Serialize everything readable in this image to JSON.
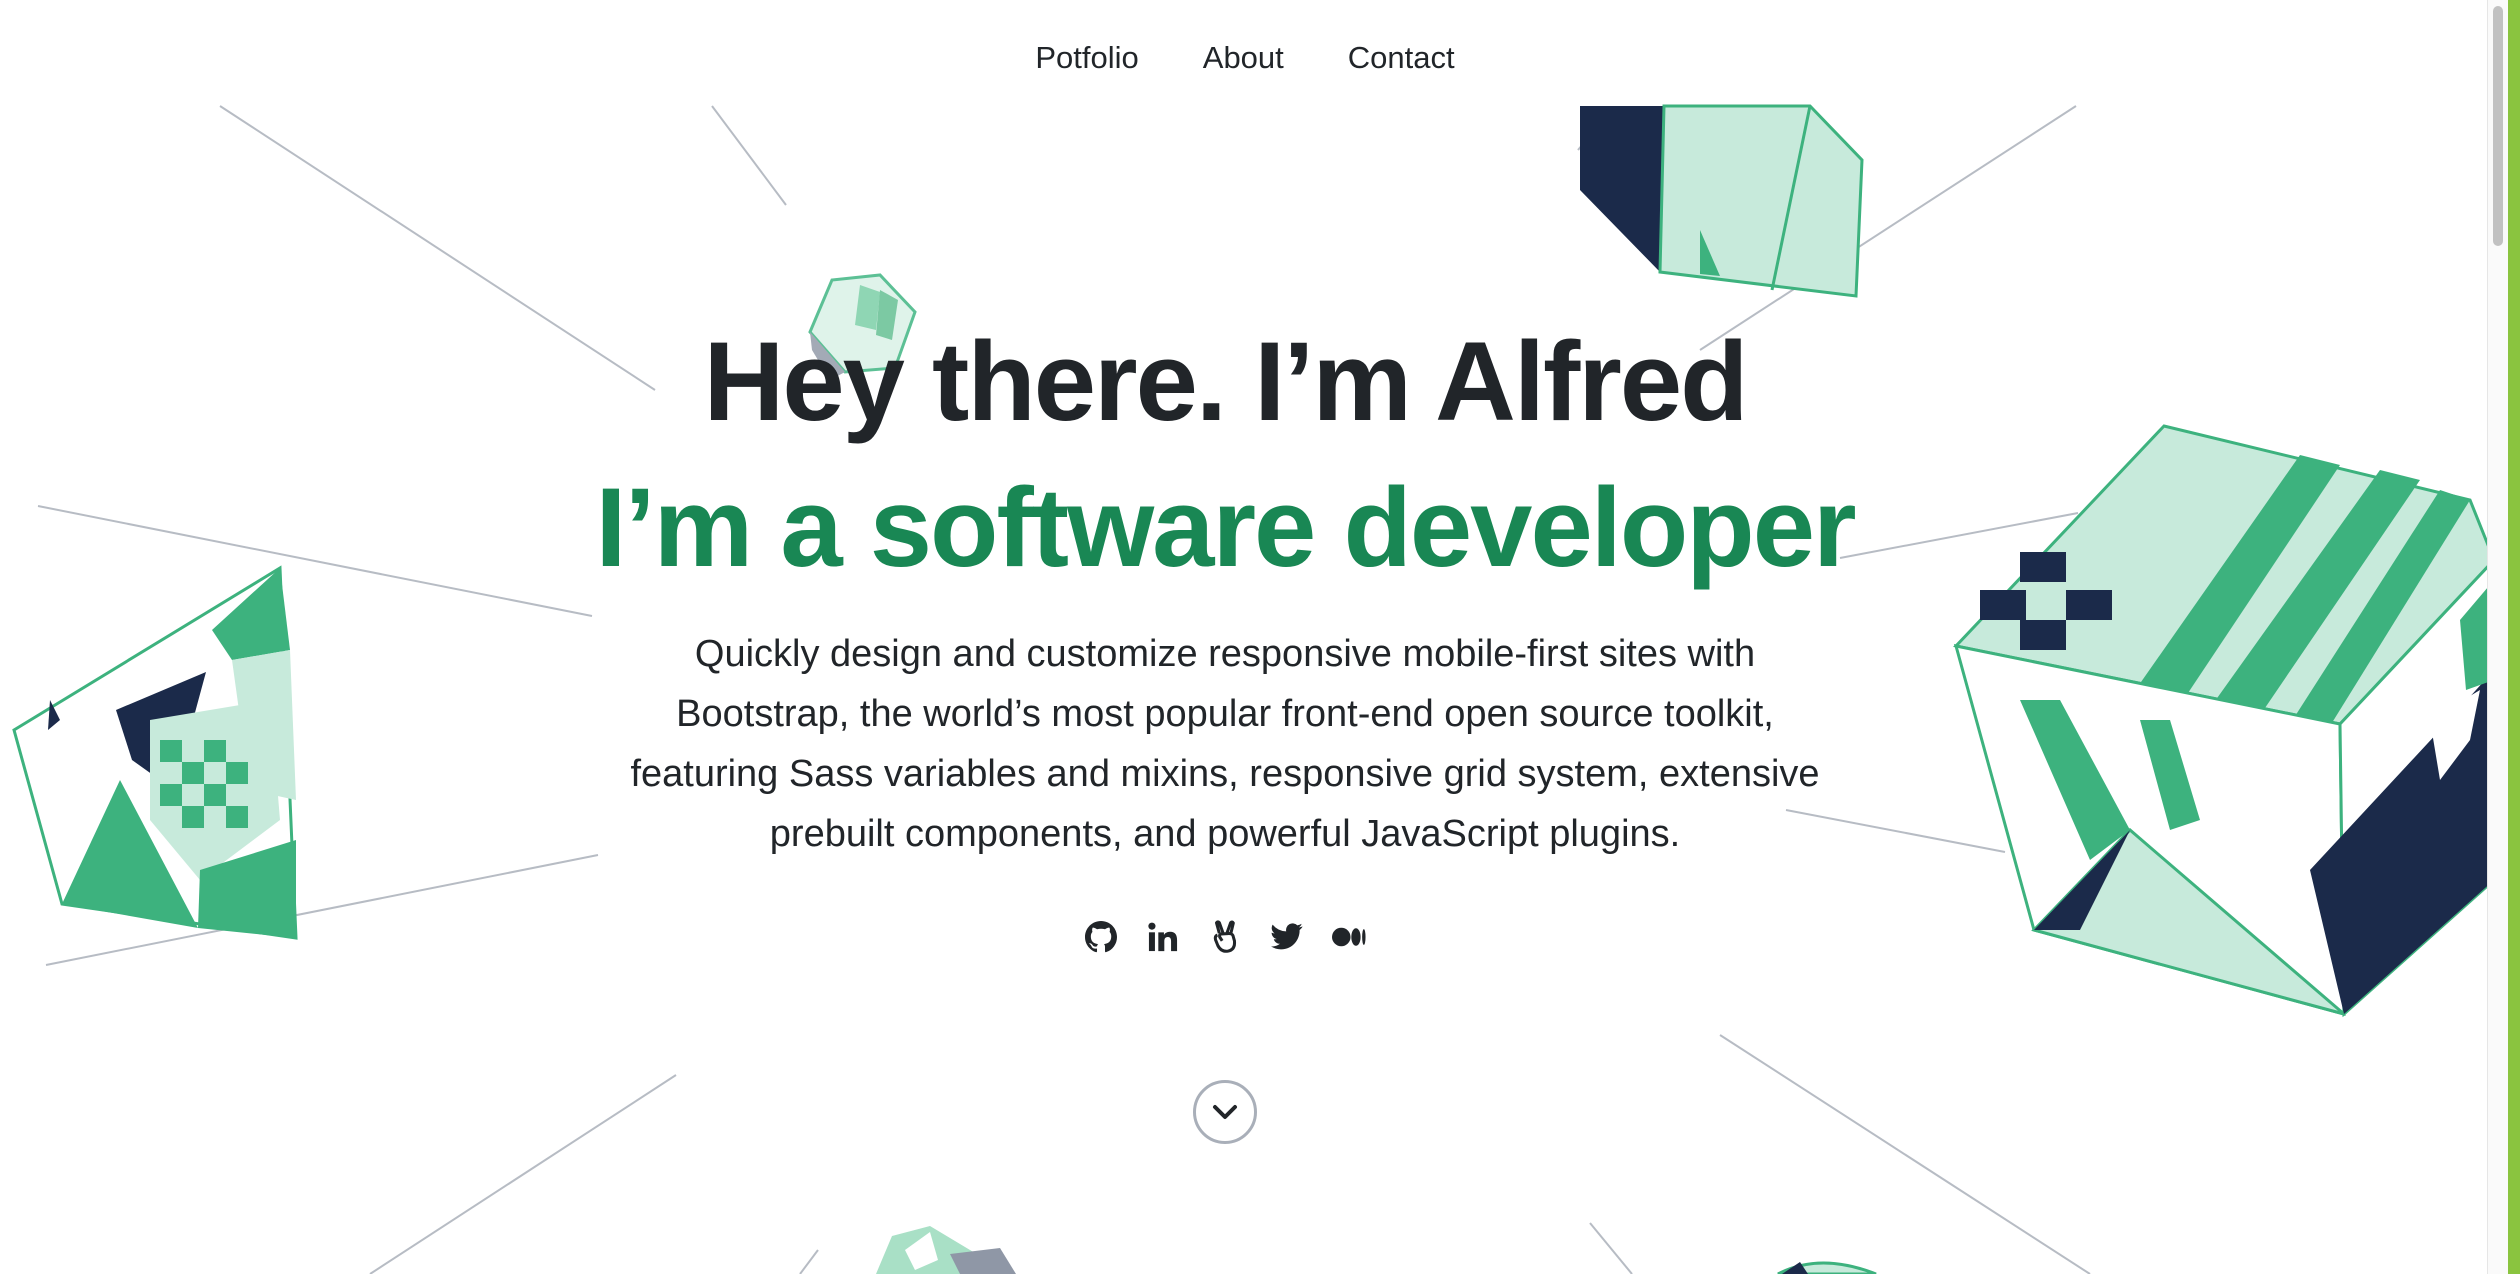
{
  "nav": {
    "items": [
      {
        "label": "Potfolio"
      },
      {
        "label": "About"
      },
      {
        "label": "Contact"
      }
    ]
  },
  "hero": {
    "title": "Hey there. I’m Alfred",
    "subtitle": "I’m a software developer",
    "description": "Quickly design and customize responsive mobile-first sites with Bootstrap, the world’s most popular front-end open source toolkit, featuring Sass variables and mixins, responsive grid system, extensive prebuilt components, and powerful JavaScript plugins."
  },
  "social": [
    {
      "icon": "github-icon"
    },
    {
      "icon": "linkedin-icon"
    },
    {
      "icon": "angellist-icon"
    },
    {
      "icon": "twitter-icon"
    },
    {
      "icon": "medium-icon"
    }
  ],
  "scroll_button": {
    "icon": "chevron-down-icon"
  },
  "colors": {
    "text": "#212529",
    "accent_green": "#198754",
    "shape_green": "#3db27e",
    "shape_light": "#c7eadb",
    "shape_navy": "#1b2a4a",
    "edge_bar": "#8ac43f"
  }
}
